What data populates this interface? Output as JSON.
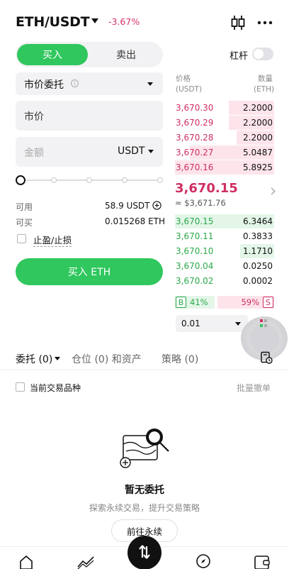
{
  "header": {
    "pair": "ETH/USDT",
    "change": "-3.67%",
    "icons": [
      "candlestick-icon",
      "more-icon"
    ]
  },
  "trade": {
    "buy_tab": "买入",
    "sell_tab": "卖出",
    "leverage_label": "杠杆",
    "order_type": "市价委托",
    "price_placeholder": "市价",
    "amount_placeholder": "金额",
    "amount_unit": "USDT",
    "available_label": "可用",
    "available_value": "58.9 USDT",
    "can_buy_label": "可买",
    "can_buy_value": "0.015268 ETH",
    "tpsl_label": "止盈/止损",
    "buy_button": "买入 ETH"
  },
  "orderbook": {
    "price_header": "价格",
    "price_unit": "(USDT)",
    "qty_header": "数量",
    "qty_unit": "(ETH)",
    "asks": [
      {
        "price": "3,670.30",
        "qty": "2.2000",
        "depth": 0.46
      },
      {
        "price": "3,670.29",
        "qty": "2.2000",
        "depth": 0.46
      },
      {
        "price": "3,670.28",
        "qty": "2.2000",
        "depth": 0.38
      },
      {
        "price": "3,670.27",
        "qty": "5.0487",
        "depth": 0.85
      },
      {
        "price": "3,670.16",
        "qty": "5.8925",
        "depth": 1.0
      }
    ],
    "last_price": "3,670.15",
    "last_fiat": "≈ $3,671.76",
    "bids": [
      {
        "price": "3,670.15",
        "qty": "6.3464",
        "depth": 1.0
      },
      {
        "price": "3,670.11",
        "qty": "0.3833",
        "depth": 0.0
      },
      {
        "price": "3,670.10",
        "qty": "1.1710",
        "depth": 0.34
      },
      {
        "price": "3,670.04",
        "qty": "0.0250",
        "depth": 0.0
      },
      {
        "price": "3,670.02",
        "qty": "0.0002",
        "depth": 0.0
      }
    ],
    "buy_badge": "B",
    "buy_ratio": "41%",
    "sell_ratio": "59%",
    "sell_badge": "S",
    "depth_step": "0.01"
  },
  "lower_tabs": {
    "orders": "委托 (0)",
    "positions": "仓位 (0) 和资产",
    "strategies": "策略 (0)",
    "current_pair_label": "当前交易品种",
    "batch_cancel": "批量撤单"
  },
  "empty_state": {
    "title": "暂无委托",
    "subtitle": "探索永续交易，提升交易策略",
    "button": "前往永续"
  },
  "colors": {
    "green": "#30c75e",
    "red": "#cf2f62"
  }
}
